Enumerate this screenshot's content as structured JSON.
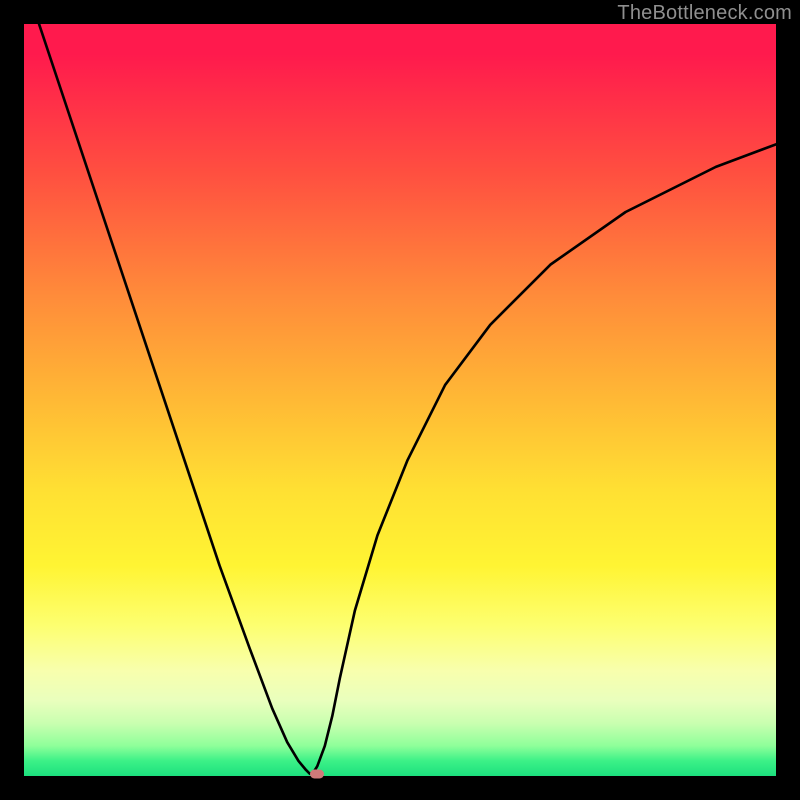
{
  "watermark": "TheBottleneck.com",
  "chart_data": {
    "type": "line",
    "title": "",
    "xlabel": "",
    "ylabel": "",
    "xlim": [
      0,
      100
    ],
    "ylim": [
      0,
      100
    ],
    "grid": false,
    "series": [
      {
        "name": "curve",
        "x": [
          2,
          6,
          10,
          14,
          18,
          22,
          26,
          30,
          33,
          35,
          36.5,
          37.5,
          38,
          38.5,
          39,
          40,
          41,
          42,
          44,
          47,
          51,
          56,
          62,
          70,
          80,
          92,
          100
        ],
        "y": [
          100,
          88,
          76,
          64,
          52,
          40,
          28,
          17,
          9,
          4.5,
          2,
          0.8,
          0.3,
          0.5,
          1.3,
          4,
          8,
          13,
          22,
          32,
          42,
          52,
          60,
          68,
          75,
          81,
          84
        ]
      }
    ],
    "marker": {
      "x": 39,
      "y": 0.3,
      "color": "#cf7a7a"
    },
    "background": {
      "type": "vertical-gradient",
      "stops": [
        {
          "pos": 0.0,
          "color": "#ff1a4d"
        },
        {
          "pos": 0.5,
          "color": "#ffb935"
        },
        {
          "pos": 0.8,
          "color": "#fdff70"
        },
        {
          "pos": 1.0,
          "color": "#1ce07e"
        }
      ]
    }
  }
}
